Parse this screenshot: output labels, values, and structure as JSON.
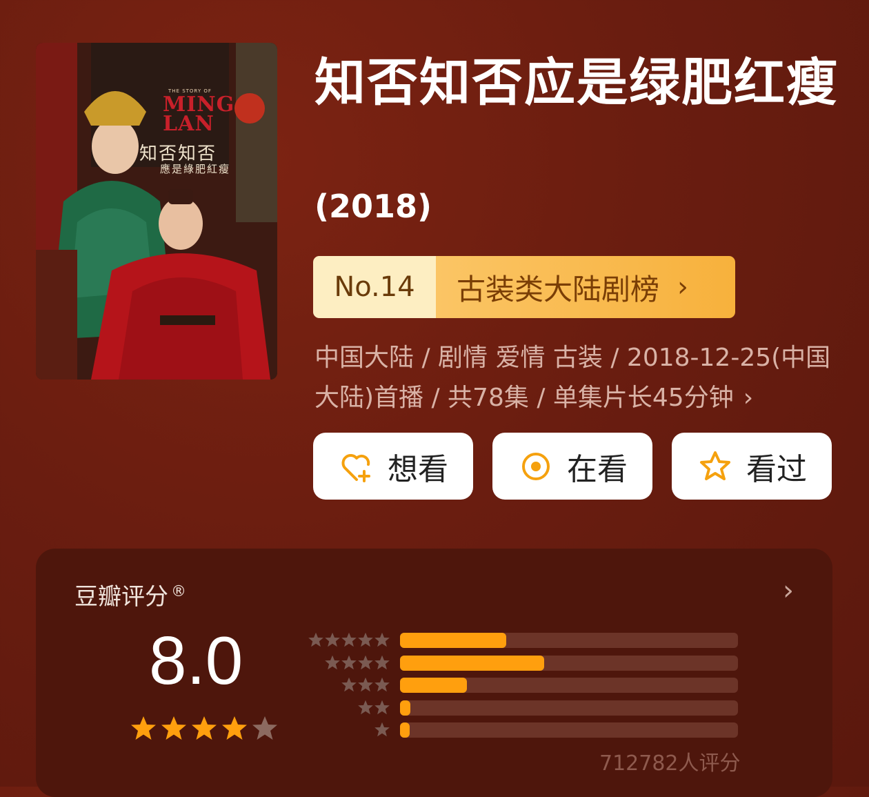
{
  "poster": {
    "english_title_small": "THE STORY OF",
    "english_title": "MING LAN",
    "chinese_title": "知否知否",
    "chinese_subtitle": "應是綠肥紅瘦"
  },
  "title": "知否知否应是绿肥红瘦",
  "year": "(2018)",
  "ranking": {
    "number": "No.14",
    "list_name": "古装类大陆剧榜",
    "arrow": "›"
  },
  "meta_text": "中国大陆 / 剧情 爱情 古装 / 2018-12-25(中国大陆)首播 / 共78集 / 单集片长45分钟",
  "meta_arrow": "›",
  "actions": [
    {
      "label": "想看",
      "icon": "heart-plus-icon"
    },
    {
      "label": "在看",
      "icon": "target-icon"
    },
    {
      "label": "看过",
      "icon": "star-outline-icon"
    }
  ],
  "rating": {
    "label": "豆瓣评分",
    "registered": "®",
    "arrow": "›",
    "score": "8.0",
    "stars_filled": 4,
    "stars_total": 5,
    "count_text": "712782人评分",
    "distribution": [
      {
        "stars": 5,
        "fraction": 0.315
      },
      {
        "stars": 4,
        "fraction": 0.427
      },
      {
        "stars": 3,
        "fraction": 0.197
      },
      {
        "stars": 2,
        "fraction": 0.03
      },
      {
        "stars": 1,
        "fraction": 0.02
      }
    ]
  },
  "colors": {
    "background": "#6a1d10",
    "accent_orange": "#ff9f0e",
    "rank_badge": "#f7b13c",
    "card": "#4e160c"
  }
}
